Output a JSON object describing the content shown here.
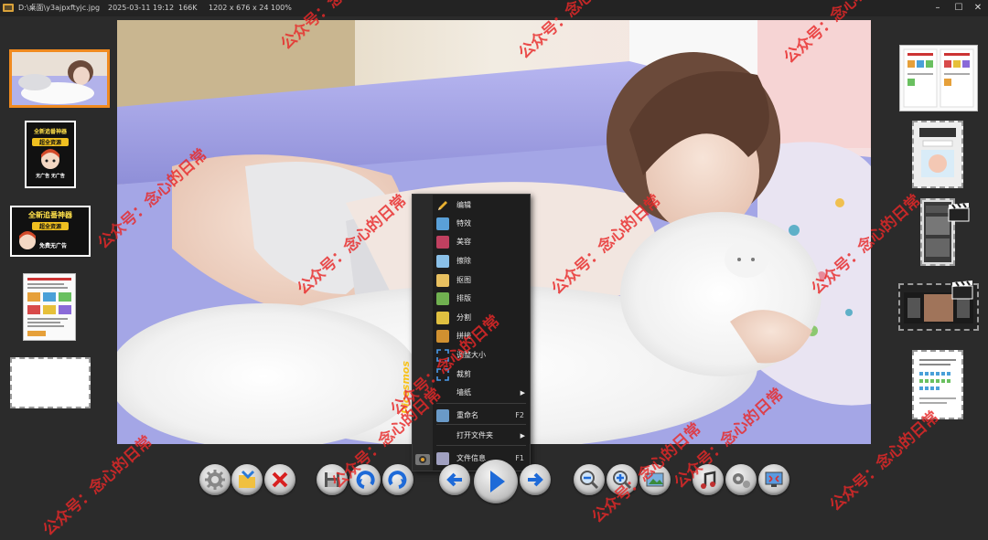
{
  "titlebar": {
    "path": "D:\\桌面\\y3ajpxftyjc.jpg",
    "datetime": "2025-03-11 19:12",
    "filesize": "166K",
    "dimensions": "1202 x 676 x 24",
    "zoom": "100%",
    "minimize": "–",
    "maximize": "☐",
    "close": "✕"
  },
  "left_thumbs": [
    {
      "kind": "photo",
      "selected": true
    },
    {
      "kind": "poster",
      "title": "全新追番神器",
      "badge": "超全资源",
      "footer": "无广告 无广告"
    },
    {
      "kind": "poster",
      "title": "全新追番神器",
      "badge": "超全资源",
      "footer": "免费无广告"
    },
    {
      "kind": "document"
    },
    {
      "kind": "blank"
    }
  ],
  "right_thumbs": [
    {
      "kind": "document"
    },
    {
      "kind": "app"
    },
    {
      "kind": "screenshot"
    },
    {
      "kind": "video"
    },
    {
      "kind": "document"
    }
  ],
  "context_menu": {
    "brand": "Picosmos",
    "items": [
      {
        "label": "编辑",
        "icon": "pencil-icon",
        "color": "#e0b030"
      },
      {
        "label": "特效",
        "icon": "landscape-icon",
        "color": "#5aa0d8"
      },
      {
        "label": "美容",
        "icon": "lipstick-icon",
        "color": "#c04060"
      },
      {
        "label": "擦除",
        "icon": "eraser-icon",
        "color": "#8ac0e8"
      },
      {
        "label": "抠图",
        "icon": "cutout-icon",
        "color": "#e8c060"
      },
      {
        "label": "排版",
        "icon": "layout-icon",
        "color": "#70b050"
      },
      {
        "label": "分割",
        "icon": "split-icon",
        "color": "#e0c040"
      },
      {
        "label": "拼接",
        "icon": "collage-icon",
        "color": "#d09030"
      },
      {
        "label": "调整大小",
        "icon": "resize-icon",
        "color": "#3a8ad8"
      },
      {
        "label": "裁剪",
        "icon": "crop-icon",
        "color": "#3a8ad8"
      },
      {
        "label": "墙纸",
        "icon": "wallpaper-icon",
        "color": "#1e1e1e",
        "submenu": true
      },
      {
        "label": "重命名",
        "icon": "rename-icon",
        "color": "#6a9ac8",
        "shortcut": "F2"
      },
      {
        "label": "打开文件夹",
        "icon": "folder-icon",
        "color": "#1e1e1e",
        "submenu": true
      },
      {
        "label": "文件信息",
        "icon": "info-icon",
        "color": "#a0a0c0",
        "shortcut": "F1"
      }
    ]
  },
  "toolbar": [
    "settings",
    "open-folder",
    "delete",
    "save",
    "undo",
    "redo",
    "previous",
    "play-slideshow",
    "next",
    "zoom-out",
    "zoom-in",
    "fit-window",
    "music",
    "tools",
    "fullscreen"
  ],
  "watermark": "公众号：念心的日常"
}
